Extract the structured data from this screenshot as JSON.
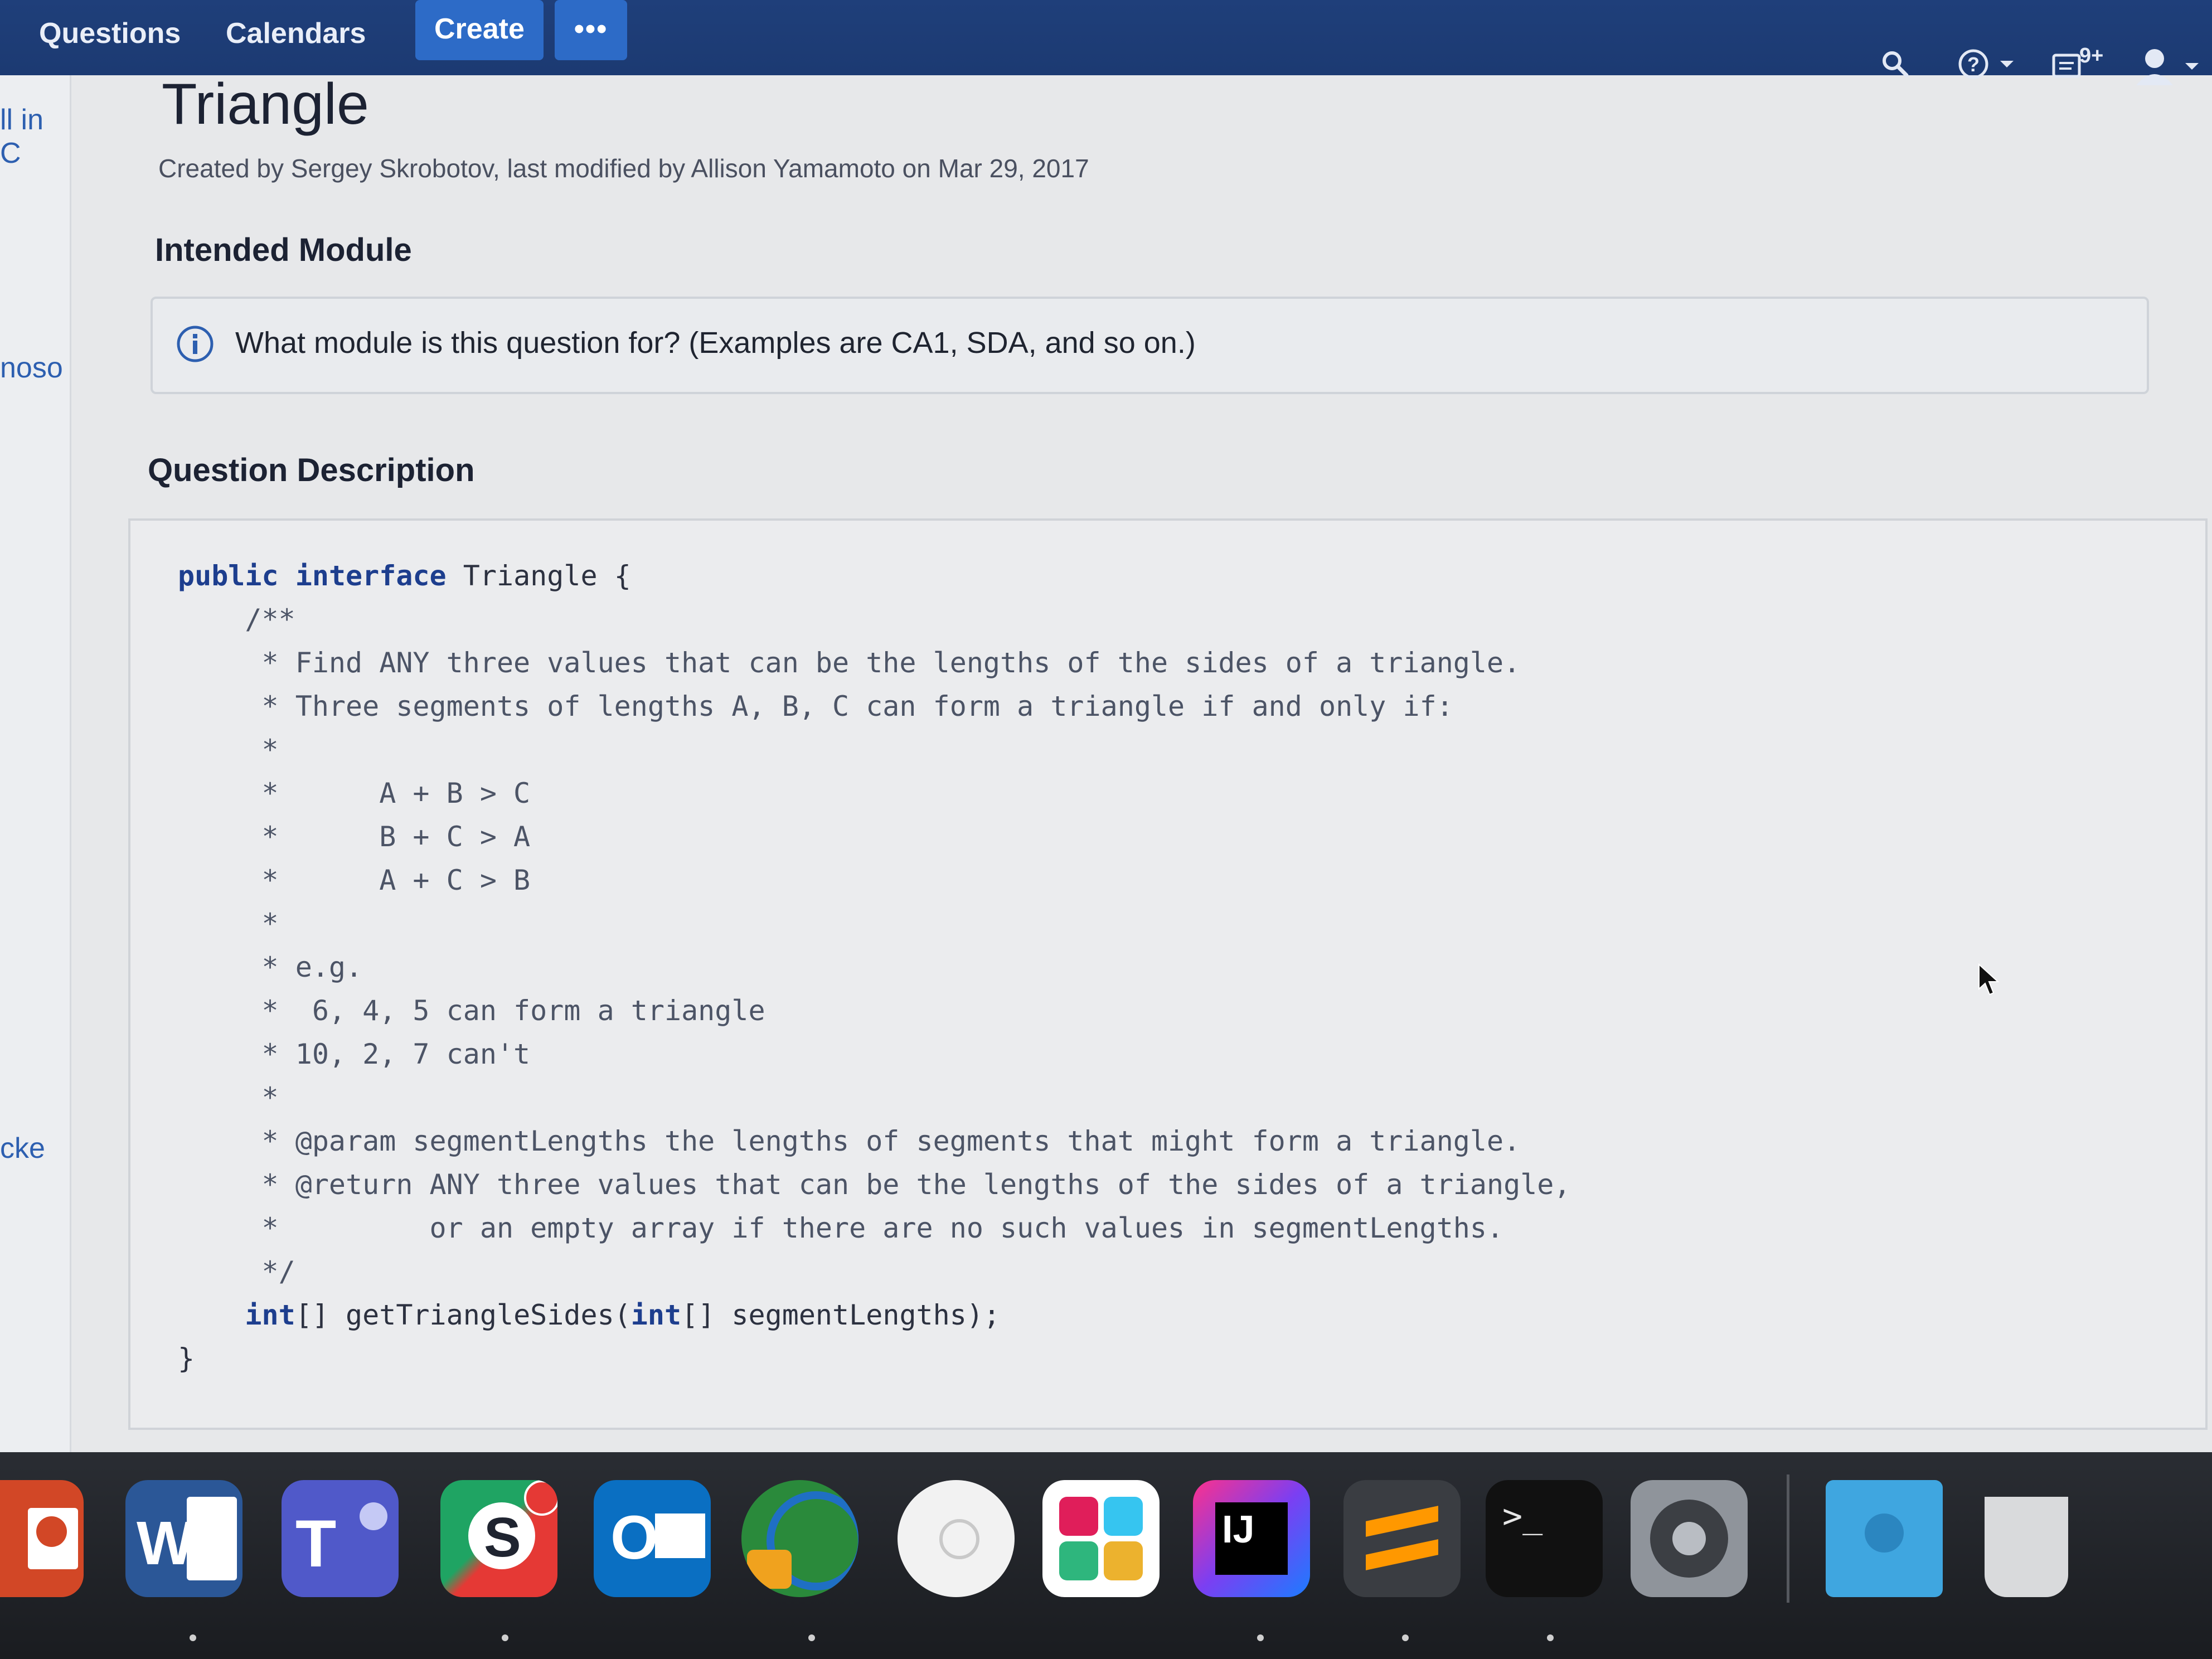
{
  "nav": {
    "questions": "Questions",
    "calendars": "Calendars",
    "create": "Create",
    "more": "•••",
    "notifications_badge": "9+"
  },
  "sidebar": {
    "fragment_1": "ll in C",
    "fragment_2": "noso",
    "fragment_3": "cke"
  },
  "page": {
    "title": "Triangle",
    "byline": "Created by Sergey Skrobotov, last modified by Allison Yamamoto on Mar 29, 2017"
  },
  "intended_module": {
    "heading": "Intended Module",
    "info_text": "What module is this question for? (Examples are CA1, SDA, and so on.)"
  },
  "question_description": {
    "heading": "Question Description",
    "code_lines": [
      "public interface Triangle {",
      "    /**",
      "     * Find ANY three values that can be the lengths of the sides of a triangle.",
      "     * Three segments of lengths A, B, C can form a triangle if and only if:",
      "     *",
      "     *      A + B > C",
      "     *      B + C > A",
      "     *      A + C > B",
      "     *",
      "     * e.g.",
      "     *  6, 4, 5 can form a triangle",
      "     * 10, 2, 7 can't",
      "     *",
      "     * @param segmentLengths the lengths of segments that might form a triangle.",
      "     * @return ANY three values that can be the lengths of the sides of a triangle,",
      "     *         or an empty array if there are no such values in segmentLengths.",
      "     */",
      "    int[] getTriangleSides(int[] segmentLengths);",
      "}"
    ]
  },
  "dock": {
    "apps": [
      "powerpoint-icon",
      "word-icon",
      "teams-icon",
      "skype-icon",
      "outlook-icon",
      "vpn-icon",
      "wifi-icon",
      "slack-icon",
      "intellij-icon",
      "sublime-icon",
      "terminal-icon",
      "system-preferences-icon",
      "downloads-folder-icon",
      "trash-icon"
    ]
  }
}
